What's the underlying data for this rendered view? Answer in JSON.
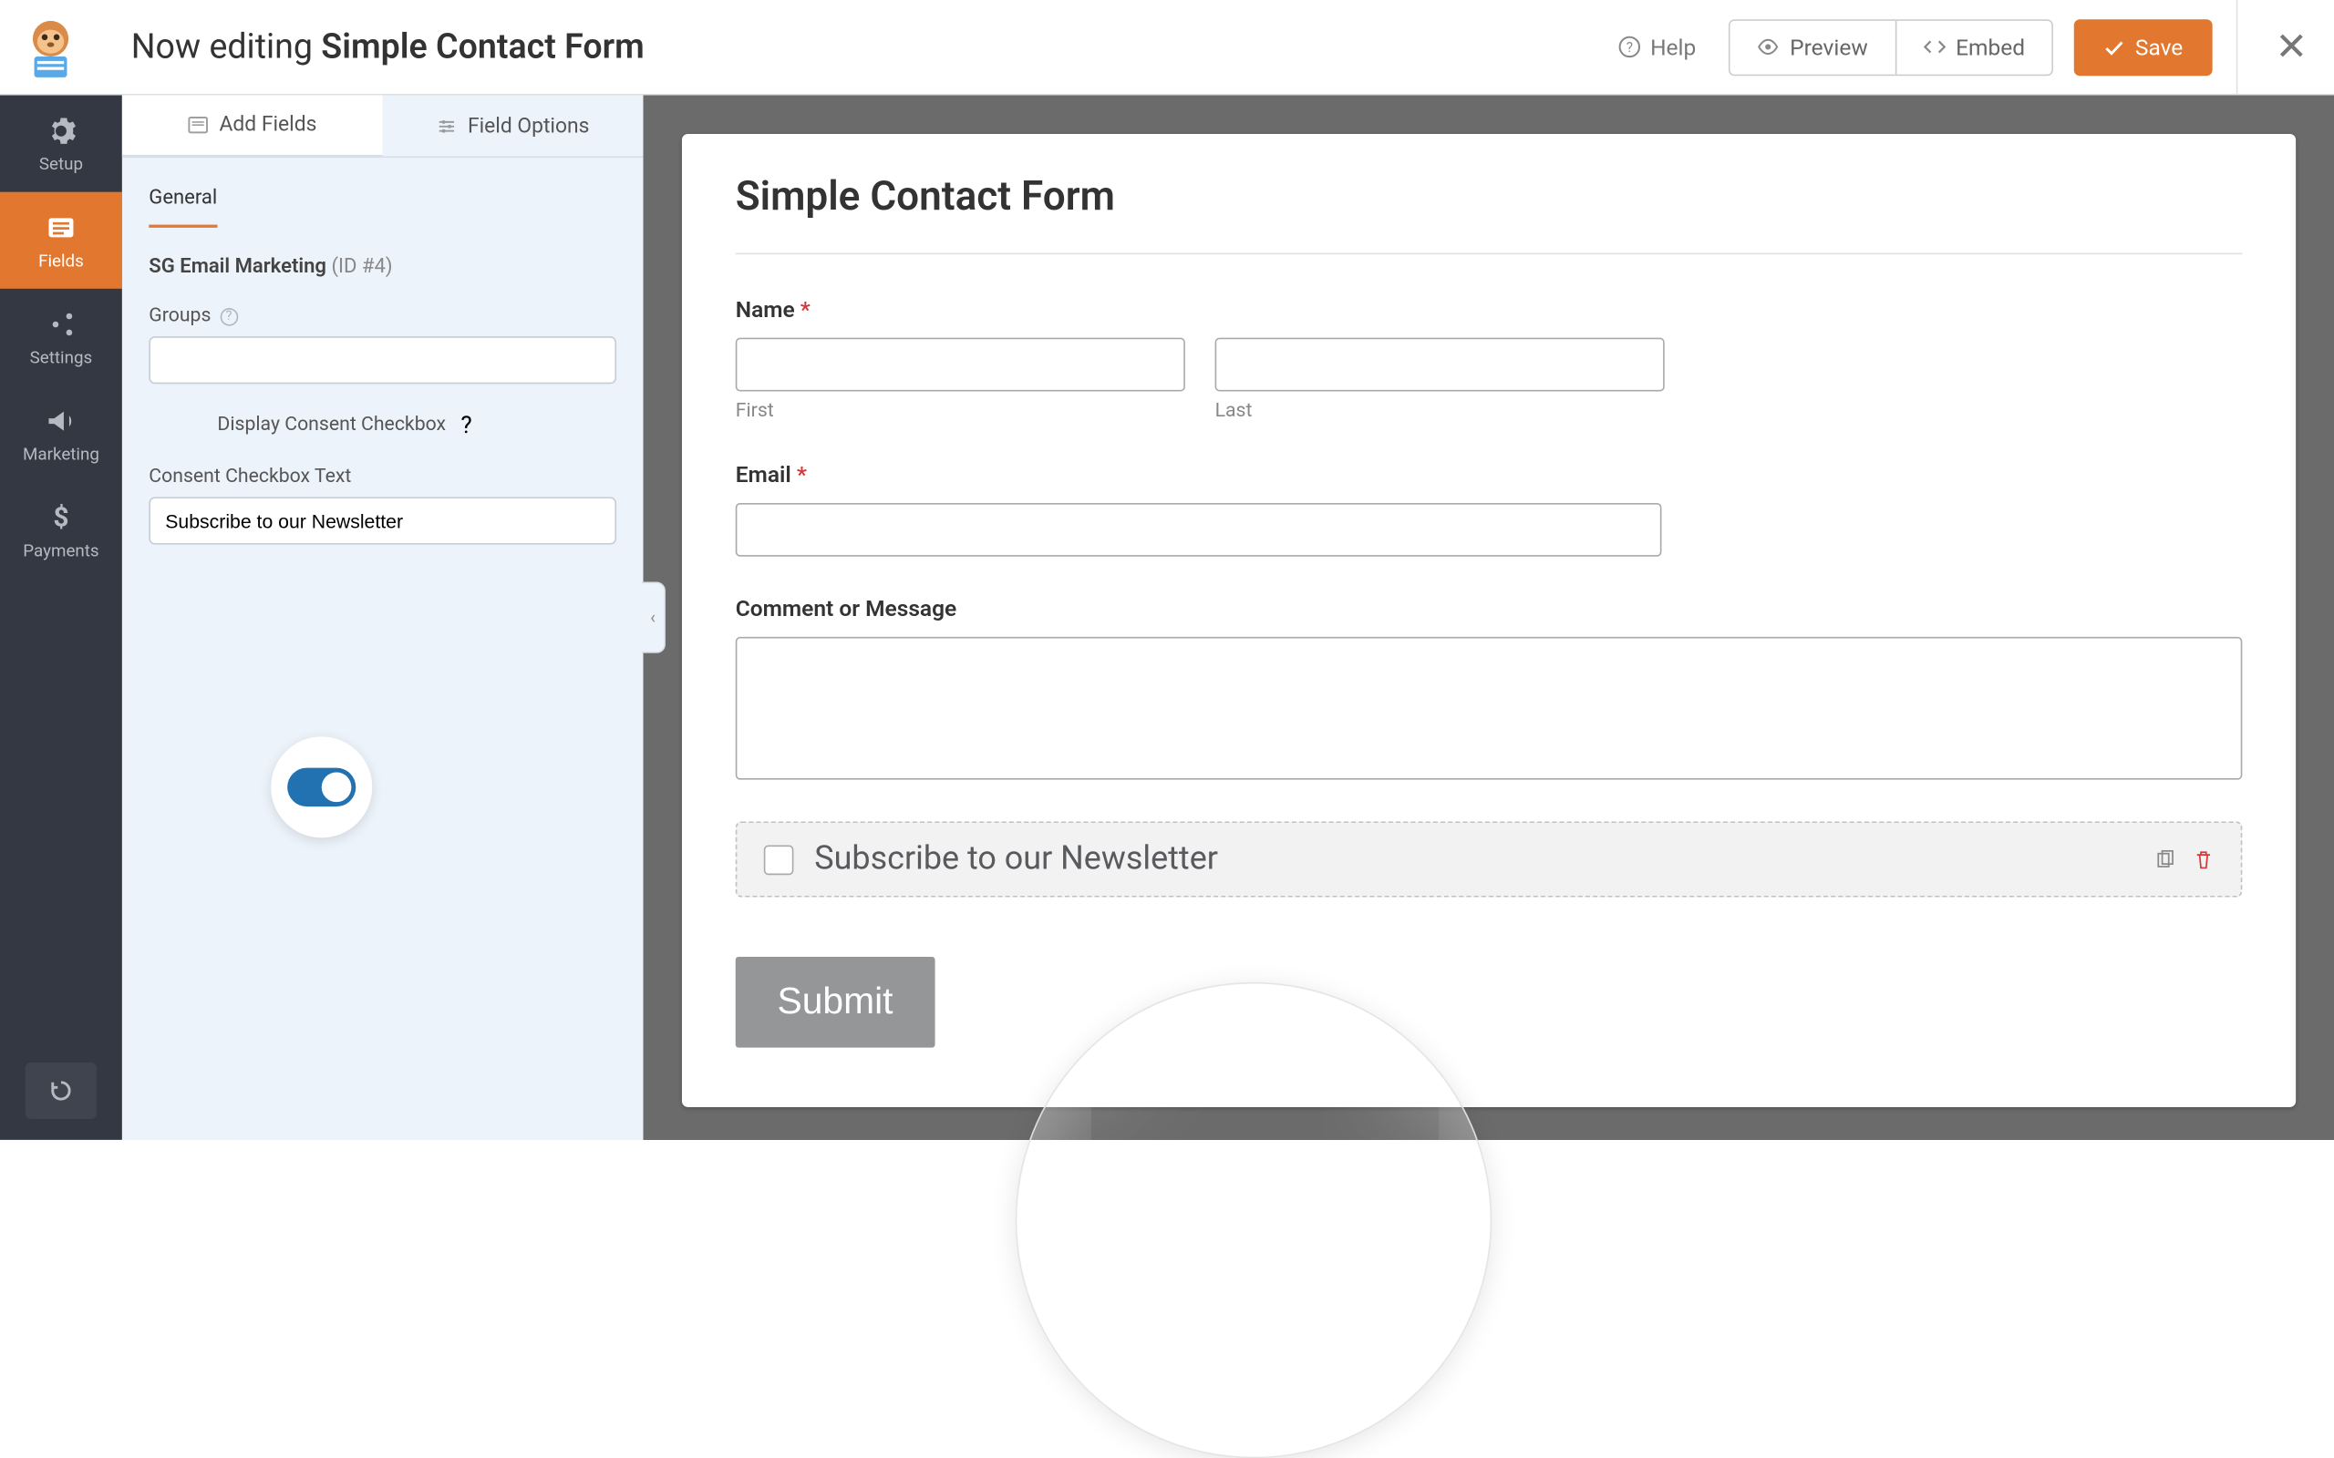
{
  "topbar": {
    "editing_prefix": "Now editing",
    "form_name": "Simple Contact Form",
    "help_label": "Help",
    "preview_label": "Preview",
    "embed_label": "Embed",
    "save_label": "Save"
  },
  "nav": {
    "setup": "Setup",
    "fields": "Fields",
    "settings": "Settings",
    "marketing": "Marketing",
    "payments": "Payments"
  },
  "panel": {
    "tab_add_fields": "Add Fields",
    "tab_field_options": "Field Options",
    "sub_tab_general": "General",
    "field_name": "SG Email Marketing",
    "field_id_suffix": "(ID #4)",
    "groups_label": "Groups",
    "groups_value": "",
    "consent_toggle_label": "Display Consent Checkbox",
    "consent_text_label": "Consent Checkbox Text",
    "consent_text_value": "Subscribe to our Newsletter"
  },
  "form": {
    "title": "Simple Contact Form",
    "name_label": "Name",
    "first_sublabel": "First",
    "last_sublabel": "Last",
    "email_label": "Email",
    "comment_label": "Comment or Message",
    "newsletter_text": "Subscribe to our Newsletter",
    "submit_label": "Submit"
  }
}
